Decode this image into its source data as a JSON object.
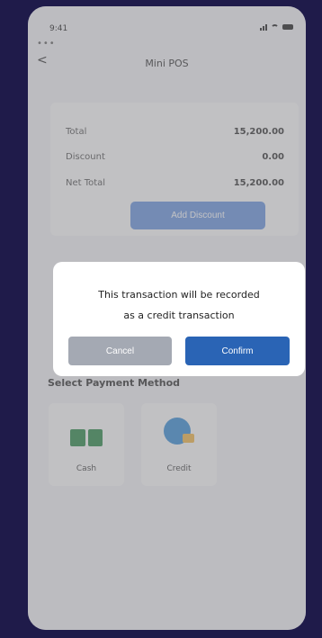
{
  "status": {
    "time": "9:41"
  },
  "header": {
    "back": "<",
    "title": "Mini POS"
  },
  "summary": {
    "rows": [
      {
        "label": "Total",
        "value": "15,200.00"
      },
      {
        "label": "Discount",
        "value": "0.00"
      },
      {
        "label": "Net Total",
        "value": "15,200.00"
      }
    ],
    "add_discount": "Add Discount"
  },
  "payment": {
    "section_title": "Select Payment Method",
    "methods": [
      {
        "label": "Cash",
        "icon": "cash-icon"
      },
      {
        "label": "Credit",
        "icon": "credit-icon"
      }
    ]
  },
  "dialog": {
    "line1": "This transaction will be recorded",
    "line2": "as a credit transaction",
    "cancel": "Cancel",
    "confirm": "Confirm"
  },
  "colors": {
    "frame": "#1f1b4a",
    "primary": "#2a64b5",
    "primary_light": "#6a95df",
    "cancel": "#a4a9b3"
  }
}
